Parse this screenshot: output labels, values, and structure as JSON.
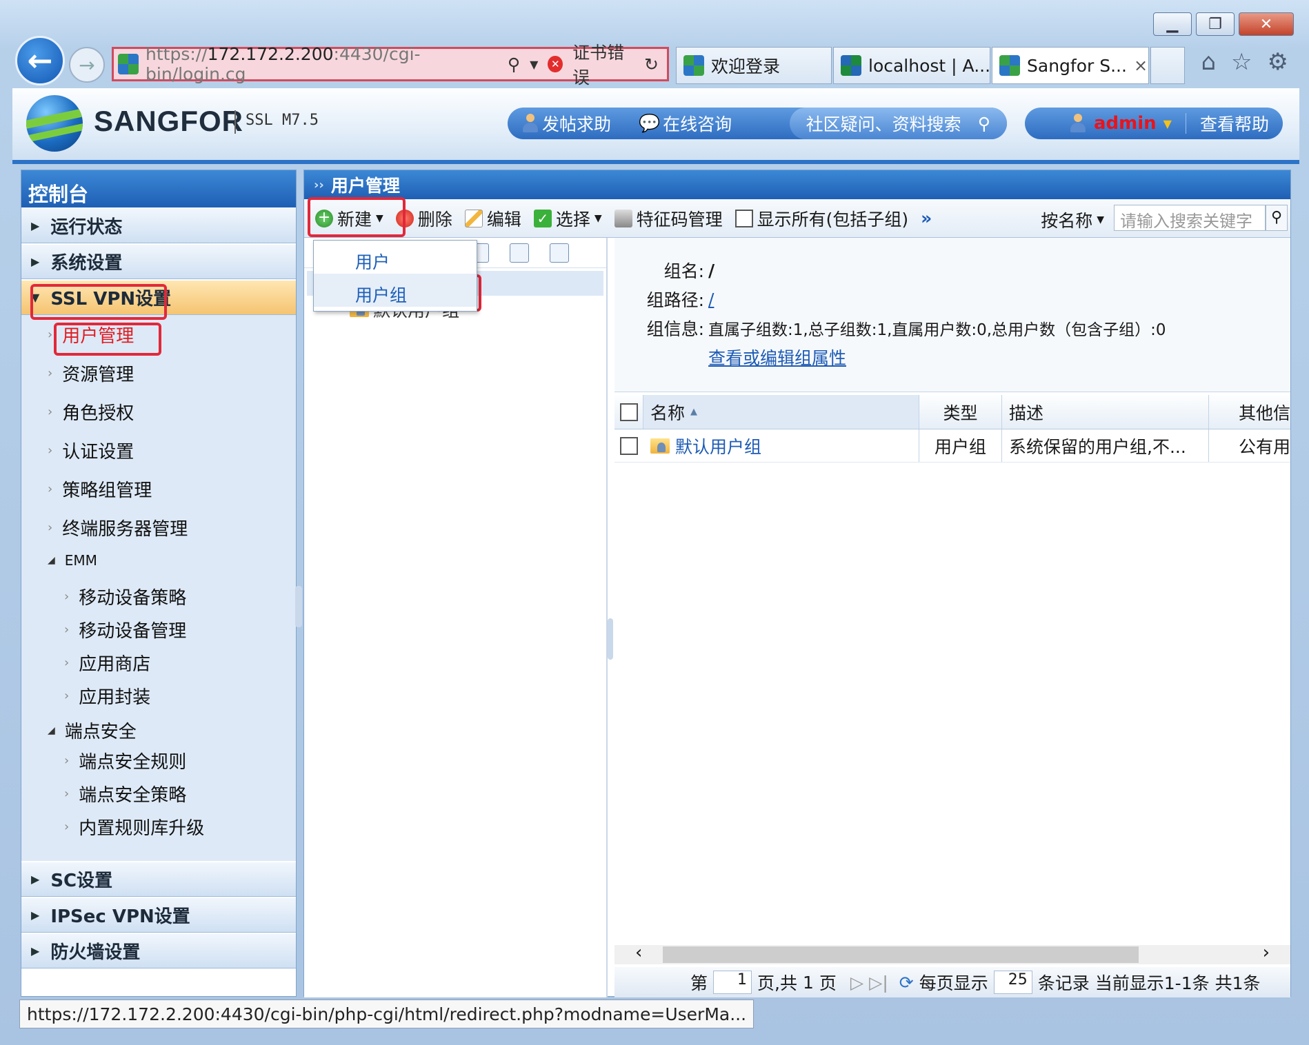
{
  "browser": {
    "url_prefix": "https://",
    "url_host": "172.172.2.200",
    "url_rest": ":4430/cgi-bin/login.cg",
    "cert_error": "证书错误",
    "tabs": [
      {
        "label": "欢迎登录"
      },
      {
        "label": "localhost | A..."
      },
      {
        "label": "Sangfor S...",
        "close": "×"
      }
    ],
    "status_url": "https://172.172.2.200:4430/cgi-bin/php-cgi/html/redirect.php?modname=UserMa..."
  },
  "header": {
    "brand": "SANGFOR",
    "version": "SSL M7.5",
    "links": [
      "发帖求助",
      "在线咨询"
    ],
    "search_label": "社区疑问、资料搜索",
    "user": "admin",
    "help": "查看帮助"
  },
  "sidebar": {
    "title": "控制台",
    "sections_top": [
      "运行状态",
      "系统设置"
    ],
    "open_section": "SSL VPN设置",
    "items": [
      {
        "label": "用户管理"
      },
      {
        "label": "资源管理"
      },
      {
        "label": "角色授权"
      },
      {
        "label": "认证设置"
      },
      {
        "label": "策略组管理"
      },
      {
        "label": "终端服务器管理"
      }
    ],
    "group_emm": "EMM",
    "emm_items": [
      "移动设备策略",
      "移动设备管理",
      "应用商店",
      "应用封装"
    ],
    "group_endpoint": "端点安全",
    "endpoint_items": [
      "端点安全规则",
      "端点安全策略",
      "内置规则库升级"
    ],
    "sections_bottom": [
      "SC设置",
      "IPSec VPN设置",
      "防火墙设置"
    ]
  },
  "main": {
    "title": "用户管理",
    "toolbar": {
      "new": "新建",
      "delete": "删除",
      "edit": "编辑",
      "select": "选择",
      "feature": "特征码管理",
      "show_all": "显示所有(包括子组)",
      "more": "»",
      "search_by": "按名称",
      "search_placeholder": "请输入搜索关键字"
    },
    "new_menu": [
      "用户",
      "用户组"
    ],
    "tree_item": "默认用户组",
    "group_info": {
      "name_label": "组名:",
      "name_value": "/",
      "path_label": "组路径:",
      "path_value": "/",
      "info_label": "组信息:",
      "info_value": "直属子组数:1,总子组数:1,直属用户数:0,总用户数（包含子组）:0",
      "edit_link": "查看或编辑组属性"
    },
    "grid": {
      "columns": [
        "名称",
        "类型",
        "描述",
        "其他信"
      ],
      "rows": [
        {
          "name": "默认用户组",
          "type": "用户组",
          "desc": "系统保留的用户组,不...",
          "other": "公有用"
        }
      ]
    },
    "pager": {
      "page_prefix": "第",
      "page_value": "1",
      "page_mid": "页,共",
      "total_pages": "1",
      "page_suffix": "页",
      "per_page_label": "每页显示",
      "per_page_value": "25",
      "records_label": "条记录",
      "current": "当前显示1-1条",
      "total": "共1条"
    }
  },
  "colors": {
    "accent": "#2c73c7",
    "highlight_box": "#e2283a",
    "admin": "#e8141c"
  }
}
